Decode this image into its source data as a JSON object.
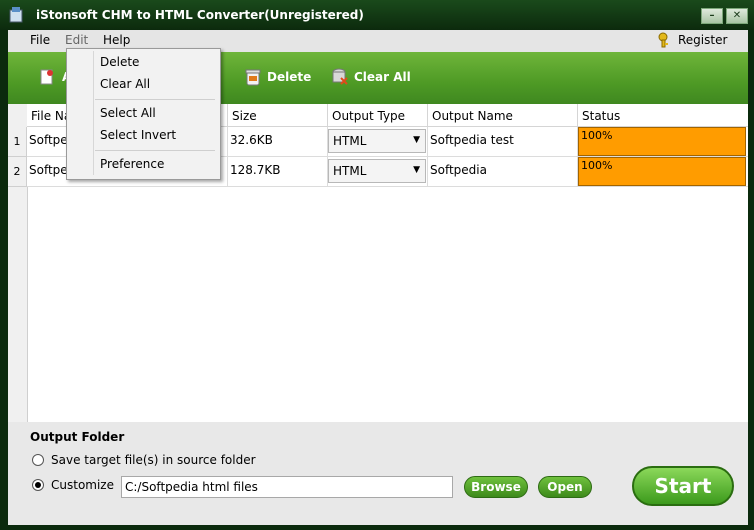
{
  "window": {
    "title": "iStonsoft CHM to HTML Converter(Unregistered)",
    "minimize": "–",
    "close": "✕"
  },
  "menubar": {
    "items": [
      "File",
      "Edit",
      "Help"
    ],
    "register": "Register"
  },
  "toolbar": {
    "add_label": "A",
    "delete_label": "Delete",
    "clear_label": "Clear All"
  },
  "edit_menu": {
    "items": [
      "Delete",
      "Clear All",
      "Select All",
      "Select Invert",
      "Preference"
    ]
  },
  "table": {
    "headers": [
      "File Na",
      "Size",
      "Output Type",
      "Output Name",
      "Status"
    ],
    "rows": [
      {
        "num": "1",
        "file": "Softpe",
        "size": "32.6KB",
        "type": "HTML",
        "name": "Softpedia test",
        "status": "100%",
        "progress": 1.0
      },
      {
        "num": "2",
        "file": "Softpe",
        "size": "128.7KB",
        "type": "HTML",
        "name": "Softpedia",
        "status": "100%",
        "progress": 1.0
      }
    ]
  },
  "output": {
    "title": "Output Folder",
    "opt_source": "Save target file(s) in source folder",
    "opt_custom": "Customize",
    "path": "C:/Softpedia html files",
    "browse": "Browse",
    "open": "Open",
    "start": "Start"
  },
  "colors": {
    "status_fill": "#ff9c00",
    "toolbar_green": "#4e9a25"
  }
}
